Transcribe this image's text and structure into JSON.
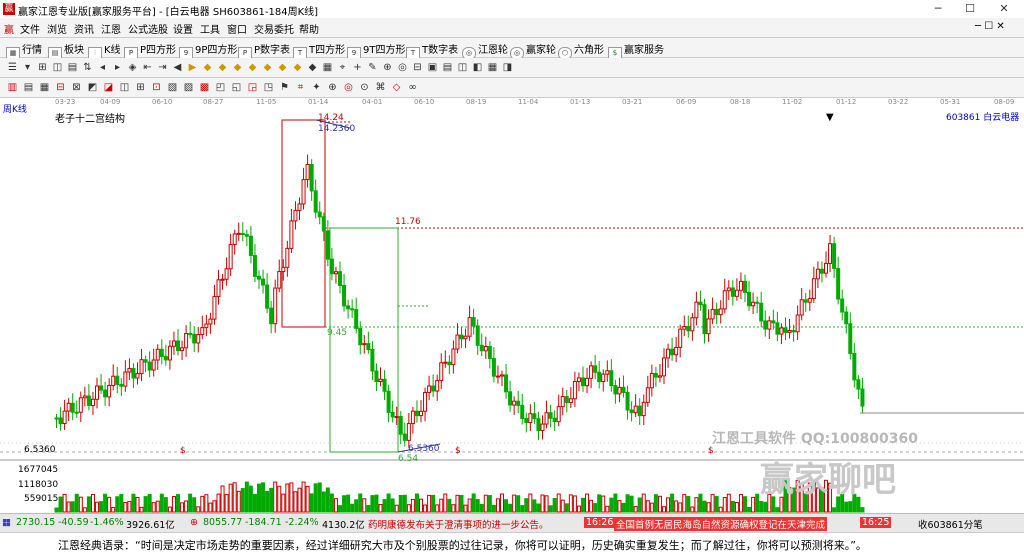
{
  "window": {
    "title": "赢家江恩专业版[赢家服务平台] - [白云电器  SH603861-184周K线]"
  },
  "menu": [
    "文件",
    "浏览",
    "资讯",
    "江恩",
    "公式选股",
    "设置",
    "工具",
    "窗口",
    "交易委托",
    "帮助"
  ],
  "toolbar": [
    "行情",
    "板块",
    "K线",
    "P四方形",
    "9P四方形",
    "P数字表",
    "T四方形",
    "9T四方形",
    "T数字表",
    "江恩轮",
    "赢家轮",
    "六角形",
    "赢家服务"
  ],
  "period_label": "周K线",
  "indicator_title": "老子十二宫结构",
  "stock_label": "603861  白云电器",
  "date_ticks": [
    "03-23",
    "04-09",
    "06-10",
    "08-27",
    "11-05",
    "01-14",
    "04-01",
    "06-10",
    "08-19",
    "11-04",
    "01-13",
    "03-21",
    "06-09",
    "08-18",
    "11-02",
    "01-12",
    "03-22",
    "05-31",
    "08-09"
  ],
  "annotations": {
    "high_price": "14.24",
    "high_label": "14.2360",
    "mid_price": "11.76",
    "low_line": "9.45",
    "low_label": "6.5360",
    "low_price": "6.54",
    "left_axis_low": "6.5360",
    "dollar": "$"
  },
  "volume_axis": [
    "1677045",
    "1118030",
    "559015"
  ],
  "watermark": {
    "line1": "江恩工具软件  QQ:100800360",
    "line2": "赢家聊吧"
  },
  "statusbar": {
    "sh": "2730.15",
    "sh_chg": "-40.59",
    "sh_pct": "-1.46%",
    "sh_amt": "3926.61亿",
    "sz": "8055.77",
    "sz_chg": "-184.71",
    "sz_pct": "-2.24%",
    "sz_amt": "4130.2亿",
    "news1": "药明康德发布关于澄清事项的进一步公告。",
    "time1": "16:26",
    "news2": "全国首例无居民海岛自然资源确权登记在天津完成",
    "time2": "16:25",
    "right": "收603861分笔"
  },
  "quote": "江恩经典语录：“时间是决定市场走势的重要因素，经过详细研究大市及个别股票的过往记录，你将可以证明，历史确实重复发生；而了解过往，你将可以预测将来。”。"
}
